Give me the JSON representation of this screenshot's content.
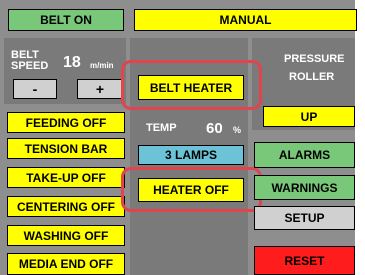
{
  "colors": {
    "panel_bg": "#8e8e8e",
    "section_bg": "#7a7a7a",
    "button_yellow": "#ffff00",
    "button_green": "#79c87a",
    "button_cyan": "#6cc3d7",
    "button_gray": "#d0d0d0",
    "button_red": "#ff1c1c",
    "highlight_ring": "#e0444c"
  },
  "header": {
    "belt_on_label": "BELT ON",
    "mode_label": "MANUAL"
  },
  "belt_speed": {
    "label_line1": "BELT",
    "label_line2": "SPEED",
    "value": "18",
    "unit": "m/min",
    "decrease_label": "-",
    "increase_label": "+"
  },
  "left_buttons": [
    {
      "label": "FEEDING OFF"
    },
    {
      "label": "TENSION BAR"
    },
    {
      "label": "TAKE-UP OFF"
    },
    {
      "label": "CENTERING OFF"
    },
    {
      "label": "WASHING OFF"
    },
    {
      "label": "MEDIA END OFF"
    }
  ],
  "heater": {
    "belt_heater_label": "BELT HEATER",
    "temp_label": "TEMP",
    "temp_value": "60",
    "temp_unit": "%",
    "lamps_label": "3 LAMPS",
    "heater_off_label": "HEATER OFF"
  },
  "pressure_roller": {
    "title_line1": "PRESSURE",
    "title_line2": "ROLLER",
    "up_label": "UP"
  },
  "right_buttons": {
    "alarms_label": "ALARMS",
    "warnings_label": "WARNINGS",
    "setup_label": "SETUP",
    "reset_label": "RESET"
  }
}
